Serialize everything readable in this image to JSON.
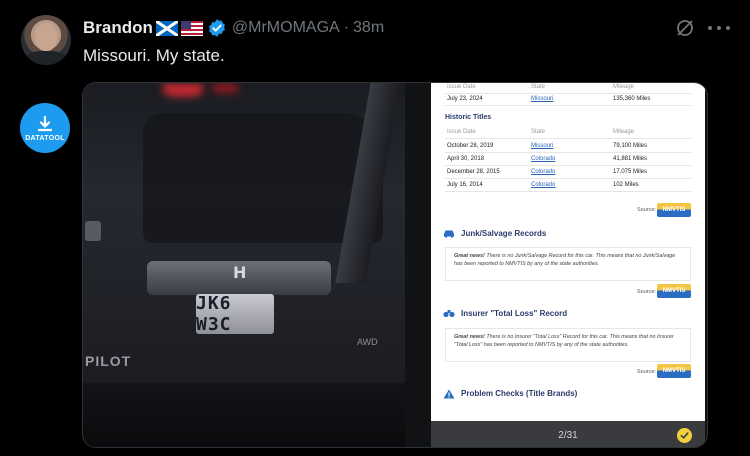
{
  "user": {
    "display_name": "Brandon",
    "handle": "@MrMOMAGA",
    "separator": "·",
    "time_ago": "38m"
  },
  "tweet": {
    "text": "Missouri. My state."
  },
  "datatool": {
    "label": "DATATOOL"
  },
  "media": {
    "photo": {
      "plate_text": "JK6 W3C",
      "model_text": "PILOT",
      "badge_text": "AWD"
    },
    "document": {
      "top_row": {
        "date": "July 23, 2024",
        "state": "Missouri",
        "mileage": "135,360 Miles"
      },
      "top_header": {
        "date": "Issue Date",
        "state": "State",
        "mileage": "Mileage"
      },
      "historic_titles_heading": "Historic Titles",
      "historic_header": {
        "date": "Issue Date",
        "state": "State",
        "mileage": "Mileage"
      },
      "historic_rows": [
        {
          "date": "October 28, 2019",
          "state": "Missouri",
          "mileage": "79,100 Miles"
        },
        {
          "date": "April 30, 2018",
          "state": "Colorado",
          "mileage": "41,881 Miles"
        },
        {
          "date": "December 28, 2015",
          "state": "Colorado",
          "mileage": "17,075 Miles"
        },
        {
          "date": "July 16, 2014",
          "state": "Colorado",
          "mileage": "102 Miles"
        }
      ],
      "source_label": "Source:",
      "nmvtis_logo": "NMVTIS",
      "junk_heading": "Junk/Salvage Records",
      "junk_note_lead": "Great news!",
      "junk_note_body": "There is no Junk/Salvage Record for this car. This means that no Junk/Salvage has been reported to NMVTIS by any of the state authorities.",
      "insurer_heading": "Insurer \"Total Loss\" Record",
      "insurer_note_lead": "Great news!",
      "insurer_note_body": "There is no Insurer \"Total Loss\" Record for this car. This means that no Insurer \"Total Loss\" has been reported to NMVTIS by any of the state authorities.",
      "problem_heading": "Problem Checks (Title Brands)"
    },
    "pager": {
      "count": "2/31"
    }
  },
  "colors": {
    "background": "#000000",
    "text_primary": "#e7e9ea",
    "text_secondary": "#71767b",
    "verified": "#1d9bf0",
    "datatool": "#1d9bf0",
    "link": "#2a65b8",
    "pager_check": "#f2d23c"
  },
  "icons": {
    "verified": "verified-badge-icon",
    "grok": "grok-icon",
    "more": "more-icon",
    "flag_scotland": "scotland-flag-icon",
    "flag_us": "us-flag-icon",
    "download": "download-icon"
  }
}
